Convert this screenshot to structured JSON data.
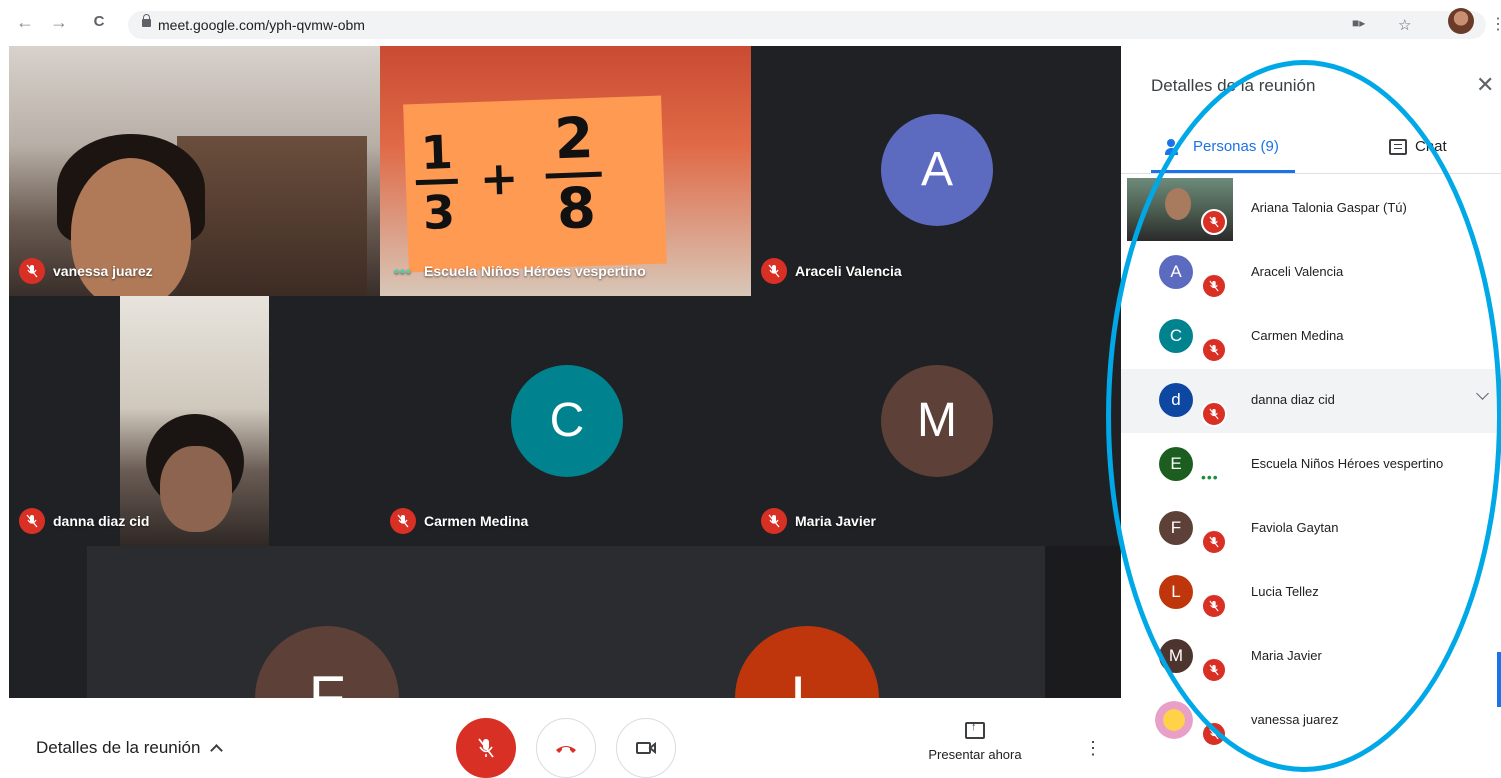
{
  "browser": {
    "url": "meet.google.com/yph-qvmw-obm",
    "back_icon": "←",
    "forward_icon": "→",
    "reload_icon": "C"
  },
  "stage": {
    "tiles": [
      {
        "name": "vanessa juarez",
        "status": "muted",
        "kind": "video"
      },
      {
        "name": "Escuela Niños Héroes vespertino",
        "status": "speaking",
        "kind": "video"
      },
      {
        "name": "Araceli Valencia",
        "status": "muted",
        "kind": "avatar",
        "initial": "A",
        "color": "#5c6bc0"
      },
      {
        "name": "danna diaz cid",
        "status": "muted",
        "kind": "video"
      },
      {
        "name": "Carmen Medina",
        "status": "muted",
        "kind": "avatar",
        "initial": "C",
        "color": "#00838f"
      },
      {
        "name": "Maria Javier",
        "status": "muted",
        "kind": "avatar",
        "initial": "M",
        "color": "#5d4037"
      },
      {
        "name": "",
        "kind": "avatar",
        "initial": "F",
        "color": "#5d4037"
      },
      {
        "name": "",
        "kind": "avatar",
        "initial": "L",
        "color": "#bf360c"
      }
    ],
    "card_fractions": {
      "a_num": "1",
      "a_den": "3",
      "plus": "+",
      "b_num": "2",
      "b_den": "8"
    }
  },
  "bottombar": {
    "details_label": "Detalles de la reunión",
    "present_label": "Presentar ahora"
  },
  "panel": {
    "title": "Detalles de la reunión",
    "tab_people": "Personas (9)",
    "tab_chat": "Chat",
    "participants": [
      {
        "name": "Ariana Talonia Gaspar (Tú)",
        "initial": "",
        "color": "",
        "status": "muted",
        "photo": true
      },
      {
        "name": "Araceli Valencia",
        "initial": "A",
        "color": "#5c6bc0",
        "status": "muted"
      },
      {
        "name": "Carmen Medina",
        "initial": "C",
        "color": "#00838f",
        "status": "muted"
      },
      {
        "name": "danna diaz cid",
        "initial": "d",
        "color": "#0d47a1",
        "status": "muted",
        "highlighted": true
      },
      {
        "name": "Escuela Niños Héroes vespertino",
        "initial": "E",
        "color": "#1b5e20",
        "status": "speaking"
      },
      {
        "name": "Faviola Gaytan",
        "initial": "F",
        "color": "#5d4037",
        "status": "muted"
      },
      {
        "name": "Lucia Tellez",
        "initial": "L",
        "color": "#bf360c",
        "status": "muted"
      },
      {
        "name": "Maria Javier",
        "initial": "M",
        "color": "#4e342e",
        "status": "muted"
      },
      {
        "name": "vanessa juarez",
        "initial": "",
        "color": "",
        "status": "muted",
        "sticker": true
      }
    ]
  },
  "colors": {
    "accent": "#1a73e8",
    "mute_red": "#d93025",
    "annotation": "#00a8e8"
  }
}
